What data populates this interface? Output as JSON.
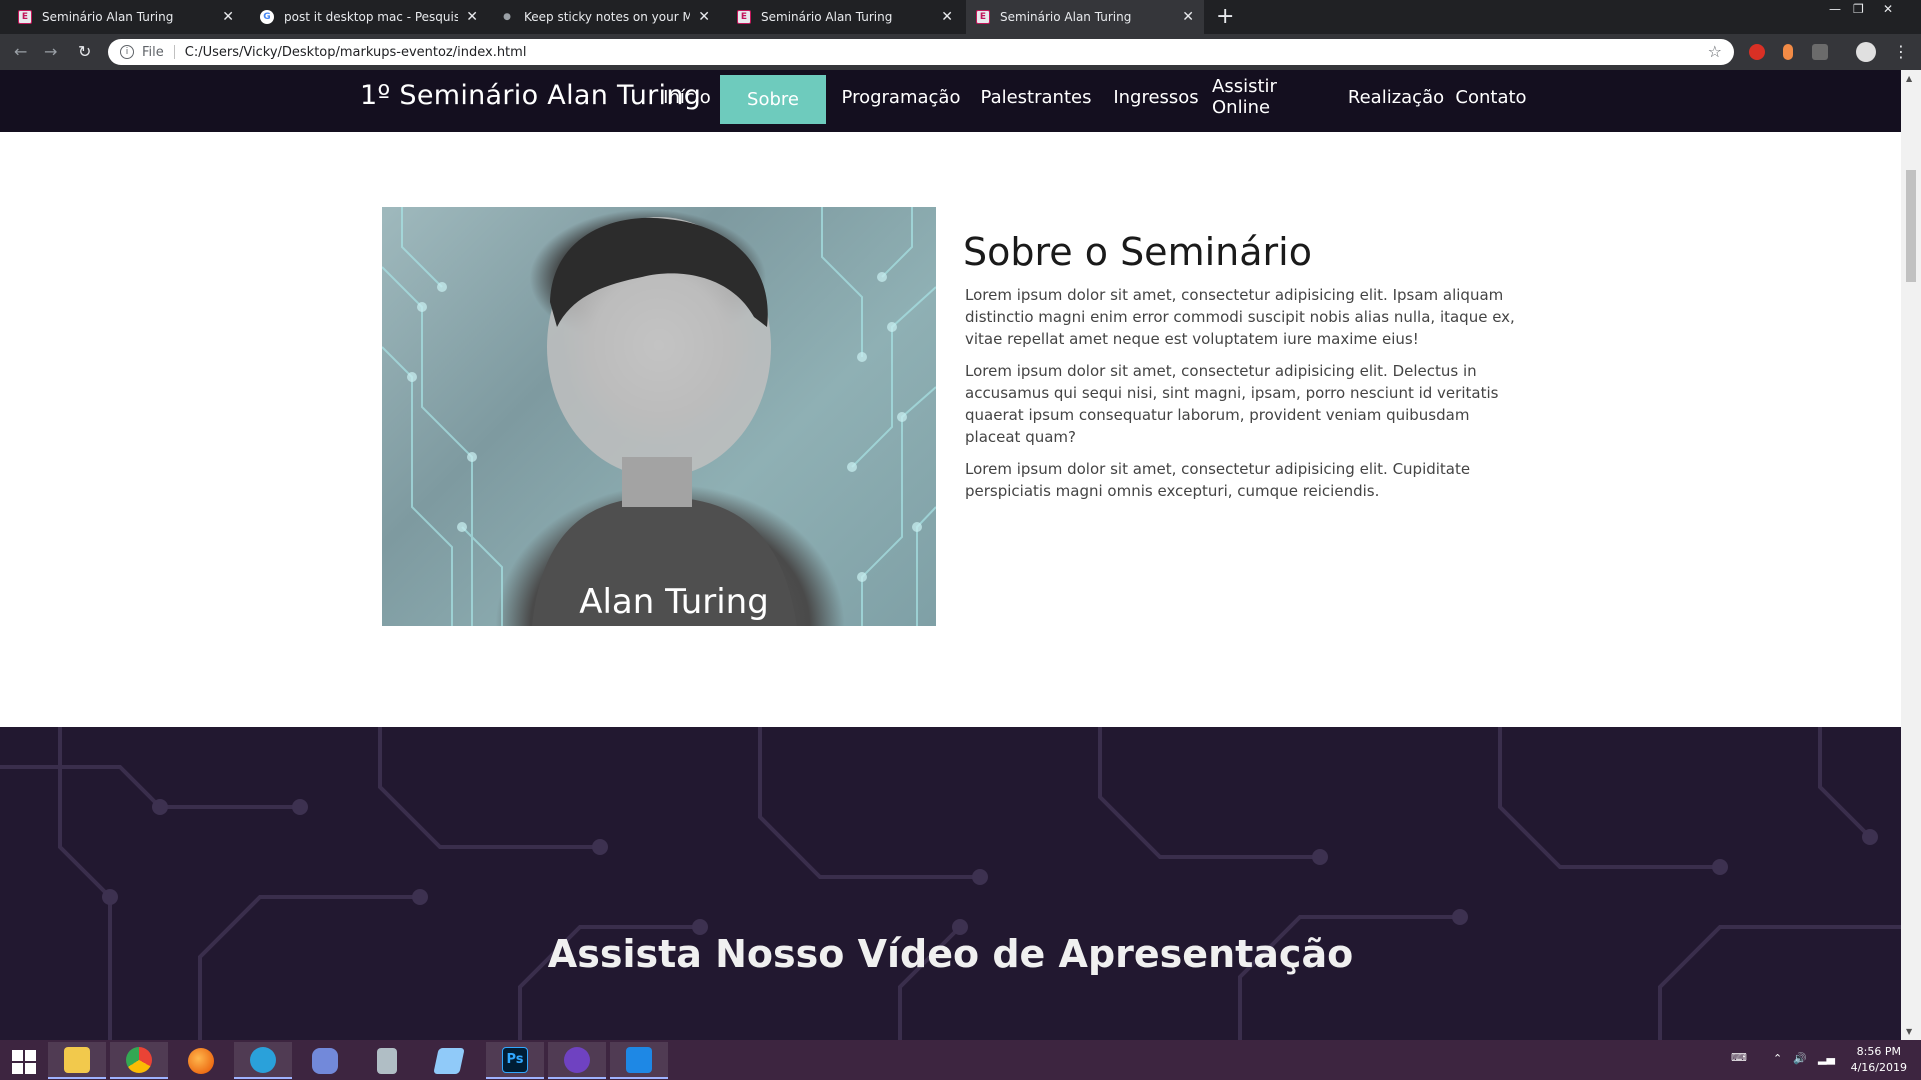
{
  "browser": {
    "tabs": [
      {
        "title": "Seminário Alan Turing",
        "favicon": "e-logo-icon"
      },
      {
        "title": "post it desktop mac - Pesquisa G",
        "favicon": "google-icon"
      },
      {
        "title": "Keep sticky notes on your Mac d",
        "favicon": "apple-icon"
      },
      {
        "title": "Seminário Alan Turing",
        "favicon": "e-logo-icon"
      },
      {
        "title": "Seminário Alan Turing",
        "favicon": "e-logo-icon"
      }
    ],
    "new_tab": "+",
    "scheme": "File",
    "url": "C:/Users/Vicky/Desktop/markups-eventoz/index.html"
  },
  "site": {
    "brand": "1º Seminário Alan Turing",
    "nav": [
      "Início",
      "Sobre",
      "Programação",
      "Palestrantes",
      "Ingressos",
      "Assistir Online",
      "Realização",
      "Contato"
    ],
    "active_nav": "Sobre",
    "accent_color": "#6ecbbd",
    "nav_bg": "#140f1f"
  },
  "about": {
    "image_caption": "Alan Turing",
    "title": "Sobre o Seminário",
    "paragraphs": [
      "Lorem ipsum dolor sit amet, consectetur adipisicing elit. Ipsam aliquam distinctio magni enim error commodi suscipit nobis alias nulla, itaque ex, vitae repellat amet neque est voluptatem iure maxime eius!",
      "Lorem ipsum dolor sit amet, consectetur adipisicing elit. Delectus in accusamus qui sequi nisi, sint magni, ipsam, porro nesciunt id veritatis quaerat ipsum consequatur laborum, provident veniam quibusdam placeat quam?",
      "Lorem ipsum dolor sit amet, consectetur adipisicing elit. Cupiditate perspiciatis magni omnis excepturi, cumque reiciendis."
    ]
  },
  "video": {
    "title": "Assista Nosso Vídeo de Apresentação"
  },
  "taskbar": {
    "apps": [
      "file-explorer-icon",
      "chrome-icon",
      "firefox-icon",
      "telegram-icon",
      "discord-icon",
      "calculator-icon",
      "notepad-icon",
      "photoshop-icon",
      "github-desktop-icon",
      "vscode-icon"
    ],
    "photoshop_label": "Ps",
    "time": "8:56 PM",
    "date": "4/16/2019"
  }
}
